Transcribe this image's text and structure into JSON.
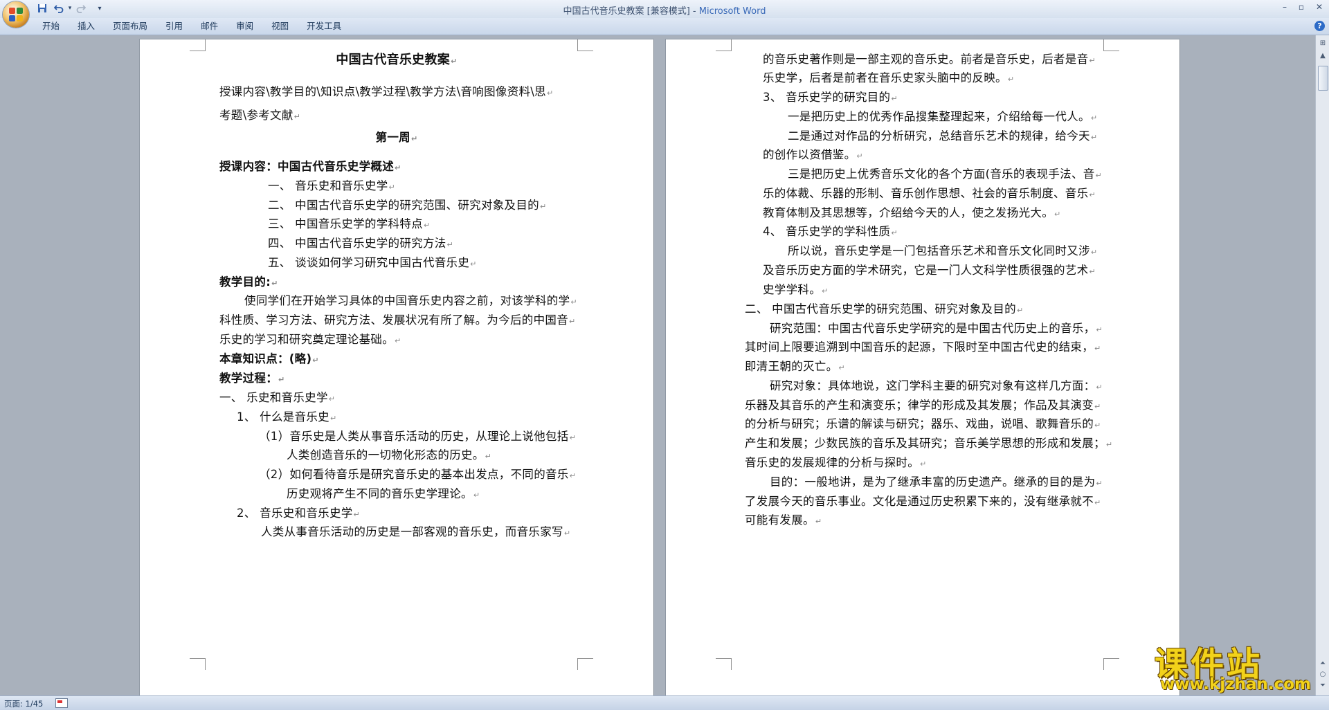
{
  "window": {
    "title": "中国古代音乐史教案 [兼容模式] - ",
    "app_name": "Microsoft Word",
    "minimize": "–",
    "maximize": "▫",
    "close": "✕"
  },
  "quick_access": {
    "save_icon": "save-icon",
    "undo_icon": "undo-icon",
    "redo_icon": "redo-icon",
    "customize": "▾"
  },
  "ribbon": {
    "tabs": [
      "开始",
      "插入",
      "页面布局",
      "引用",
      "邮件",
      "审阅",
      "视图",
      "开发工具"
    ],
    "help": "?"
  },
  "document": {
    "left_page": [
      {
        "text": "中国古代音乐史教案",
        "style": "title"
      },
      {
        "text": "授课内容\\教学目的\\知识点\\教学过程\\教学方法\\音响图像资料\\思",
        "style": "normal"
      },
      {
        "text": "考题\\参考文献",
        "style": "normal"
      },
      {
        "text": "第一周",
        "style": "heading"
      },
      {
        "text": "授课内容：中国古代音乐史学概述",
        "style": "bold"
      },
      {
        "text": "一、  音乐史和音乐史学",
        "style": "normal"
      },
      {
        "text": "二、  中国古代音乐史学的研究范围、研究对象及目的",
        "style": "normal"
      },
      {
        "text": "三、  中国音乐史学的学科特点",
        "style": "normal"
      },
      {
        "text": "四、  中国古代音乐史学的研究方法",
        "style": "normal"
      },
      {
        "text": "五、  谈谈如何学习研究中国古代音乐史",
        "style": "normal"
      },
      {
        "text": "教学目的:",
        "style": "bold"
      },
      {
        "text": "使同学们在开始学习具体的中国音乐史内容之前，对该学科的学",
        "style": "normal"
      },
      {
        "text": "科性质、学习方法、研究方法、发展状况有所了解。为今后的中国音",
        "style": "normal"
      },
      {
        "text": "乐史的学习和研究奠定理论基础。",
        "style": "normal"
      },
      {
        "text": "本章知识点：(略)",
        "style": "bold"
      },
      {
        "text": "教学过程：",
        "style": "bold"
      },
      {
        "text": "一、  乐史和音乐史学",
        "style": "normal"
      },
      {
        "text": "1、   什么是音乐史",
        "style": "normal"
      },
      {
        "text": "（1）音乐史是人类从事音乐活动的历史，从理论上说他包括",
        "style": "normal"
      },
      {
        "text": "人类创造音乐的一切物化形态的历史。",
        "style": "normal"
      },
      {
        "text": "（2）如何看待音乐是研究音乐史的基本出发点，不同的音乐",
        "style": "normal"
      },
      {
        "text": "历史观将产生不同的音乐史学理论。",
        "style": "normal"
      },
      {
        "text": "2、   音乐史和音乐史学",
        "style": "normal"
      },
      {
        "text": "人类从事音乐活动的历史是一部客观的音乐史，而音乐家写",
        "style": "normal"
      }
    ],
    "right_page": [
      {
        "text": "的音乐史著作则是一部主观的音乐史。前者是音乐史，后者是音",
        "style": "normal"
      },
      {
        "text": "乐史学，后者是前者在音乐史家头脑中的反映。",
        "style": "normal"
      },
      {
        "text": "3、   音乐史学的研究目的",
        "style": "normal"
      },
      {
        "text": "一是把历史上的优秀作品搜集整理起来，介绍给每一代人。",
        "style": "normal"
      },
      {
        "text": "二是通过对作品的分析研究，总结音乐艺术的规律，给今天",
        "style": "normal"
      },
      {
        "text": "的创作以资借鉴。",
        "style": "normal"
      },
      {
        "text": "三是把历史上优秀音乐文化的各个方面(音乐的表现手法、音",
        "style": "normal"
      },
      {
        "text": "乐的体裁、乐器的形制、音乐创作思想、社会的音乐制度、音乐",
        "style": "normal"
      },
      {
        "text": "教育体制及其思想等，介绍给今天的人，使之发扬光大。",
        "style": "normal"
      },
      {
        "text": "4、   音乐史学的学科性质",
        "style": "normal"
      },
      {
        "text": "所以说，音乐史学是一门包括音乐艺术和音乐文化同时又涉",
        "style": "normal"
      },
      {
        "text": "及音乐历史方面的学术研究，它是一门人文科学性质很强的艺术",
        "style": "normal"
      },
      {
        "text": "史学学科。",
        "style": "normal"
      },
      {
        "text": "二、  中国古代音乐史学的研究范围、研究对象及目的",
        "style": "normal"
      },
      {
        "text": "研究范围：中国古代音乐史学研究的是中国古代历史上的音乐，",
        "style": "normal"
      },
      {
        "text": "其时间上限要追溯到中国音乐的起源，下限时至中国古代史的结束，",
        "style": "normal"
      },
      {
        "text": "即清王朝的灭亡。",
        "style": "normal"
      },
      {
        "text": "研究对象：具体地说，这门学科主要的研究对象有这样几方面：",
        "style": "normal"
      },
      {
        "text": "乐器及其音乐的产生和演变乐；律学的形成及其发展；作品及其演变",
        "style": "normal"
      },
      {
        "text": "的分析与研究；乐谱的解读与研究；器乐、戏曲，说唱、歌舞音乐的",
        "style": "normal"
      },
      {
        "text": "产生和发展；少数民族的音乐及其研究；音乐美学思想的形成和发展；",
        "style": "normal"
      },
      {
        "text": "音乐史的发展规律的分析与探时。",
        "style": "normal"
      },
      {
        "text": "目的：一般地讲，是为了继承丰富的历史遗产。继承的目的是为",
        "style": "normal"
      },
      {
        "text": "了发展今天的音乐事业。文化是通过历史积累下来的，没有继承就不",
        "style": "normal"
      },
      {
        "text": "可能有发展。",
        "style": "normal"
      }
    ],
    "paragraph_mark": "↵"
  },
  "status_bar": {
    "page_count": "页面: 1/45"
  },
  "watermark": {
    "text_cn": "课件站",
    "url": "www.kjzhan.com"
  },
  "colors": {
    "accent": "#3a6ab8",
    "workspace": "#a9b1bc",
    "watermark": "#f2d21a"
  }
}
